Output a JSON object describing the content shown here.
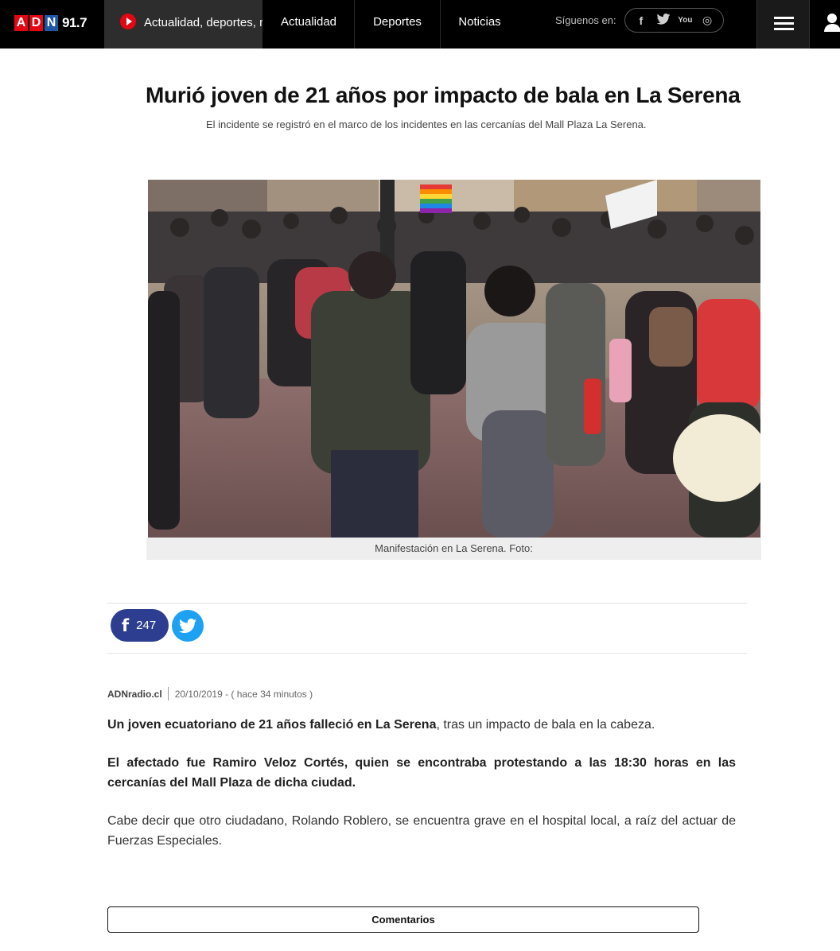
{
  "header": {
    "logo_letters": [
      "A",
      "D",
      "N"
    ],
    "logo_freq": "91.7",
    "live_label": "Actualidad, deportes, n",
    "nav": [
      "Actualidad",
      "Deportes",
      "Noticias"
    ],
    "follow_label": "Síguenos en:",
    "social_icons": [
      "facebook-icon",
      "twitter-icon",
      "youtube-icon",
      "instagram-icon"
    ],
    "social_glyphs": [
      "f",
      "t",
      "You",
      "◎"
    ]
  },
  "article": {
    "title": "Murió joven de 21 años por impacto de bala en La Serena",
    "subtitle": "El incidente se registró en el marco de los incidentes en las cercanías del Mall Plaza La Serena.",
    "image_caption": "Manifestación en La Serena. Foto:",
    "share": {
      "facebook_glyph": "f",
      "facebook_count": "247"
    },
    "meta": {
      "source": "ADNradio.cl",
      "date": "20/10/2019 - ( hace 34 minutos )"
    },
    "paragraphs": [
      {
        "bold": "Un joven ecuatoriano de 21 años falleció en La Serena",
        "rest": ", tras un impacto de bala en la cabeza."
      },
      {
        "bold": "El afectado fue Ramiro Veloz Cortés, quien se encontraba protestando a las 18:30 horas en las cercanías del Mall Plaza de dicha ciudad.",
        "rest": ""
      },
      {
        "bold": "",
        "rest": "Cabe decir que otro ciudadano, Rolando Roblero, se encuentra grave en el hospital local, a raíz del actuar de Fuerzas Especiales."
      }
    ],
    "comments_label": "Comentarios"
  },
  "colors": {
    "brand_red": "#e30613",
    "brand_blue": "#1d57a6",
    "facebook": "#2d3e91",
    "twitter": "#1da1f2"
  }
}
